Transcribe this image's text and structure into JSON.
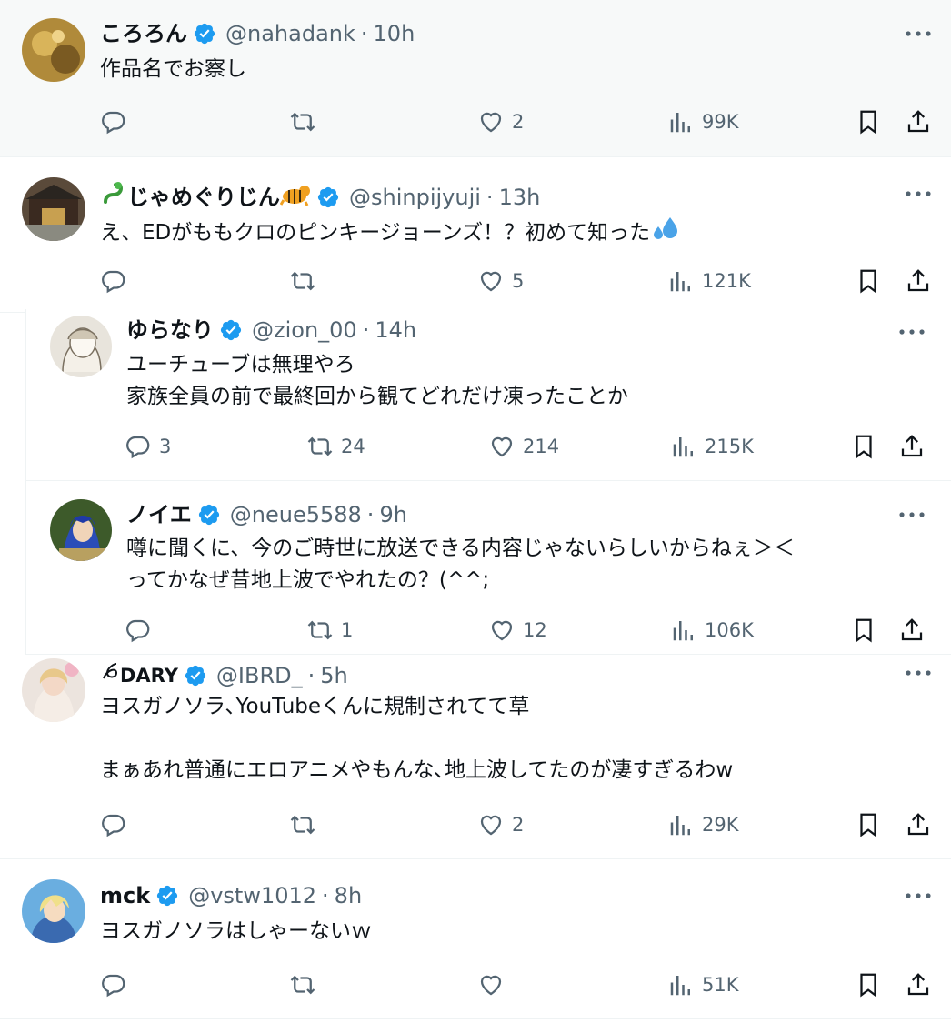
{
  "tweets": [
    {
      "name": "ころろん",
      "handle": "@nahadank",
      "time": "10h",
      "lines": [
        "作品名でお察し"
      ],
      "replies": "",
      "retweets": "",
      "likes": "2",
      "views": "99K"
    },
    {
      "name": "じゃめぐりじん",
      "handle": "@shinpijyuji",
      "time": "13h",
      "lines": [
        "え、EDがももクロのピンキージョーンズ！？初めて知った"
      ],
      "replies": "",
      "retweets": "",
      "likes": "5",
      "views": "121K"
    },
    {
      "name": "ゆらなり",
      "handle": "@zion_00",
      "time": "14h",
      "lines": [
        "ユーチューブは無理やろ",
        "家族全員の前で最終回から観てどれだけ凍ったことか"
      ],
      "replies": "3",
      "retweets": "24",
      "likes": "214",
      "views": "215K"
    },
    {
      "name": "ノイエ",
      "handle": "@neue5588",
      "time": "9h",
      "lines": [
        "噂に聞くに、今のご時世に放送できる内容じゃないらしいからねぇ＞＜",
        "ってかなぜ昔地上波でやれたの？(^^;"
      ],
      "replies": "",
      "retweets": "1",
      "likes": "12",
      "views": "106K"
    },
    {
      "name": "DARY",
      "handle": "@IBRD_",
      "time": "5h",
      "lines": [
        "ヨスガノソラ､YouTubeくんに規制されてて草",
        "",
        "まぁあれ普通にエロアニメやもんな､地上波してたのが凄すぎるわw"
      ],
      "replies": "",
      "retweets": "",
      "likes": "2",
      "views": "29K"
    },
    {
      "name": "mck",
      "handle": "@vstw1012",
      "time": "8h",
      "lines": [
        "ヨスガノソラはしゃーないｗ"
      ],
      "replies": "",
      "retweets": "",
      "likes": "",
      "views": "51K"
    }
  ],
  "colors": {
    "verified": "#1d9bf0",
    "secondary_text": "#536471",
    "primary_text": "#0f1419",
    "divider": "#eff3f4"
  },
  "icons": {
    "reply": "reply-icon",
    "retweet": "retweet-icon",
    "like": "like-icon",
    "views": "views-icon",
    "bookmark": "bookmark-icon",
    "share": "share-icon",
    "more": "more-icon",
    "verified": "verified-badge-icon"
  }
}
